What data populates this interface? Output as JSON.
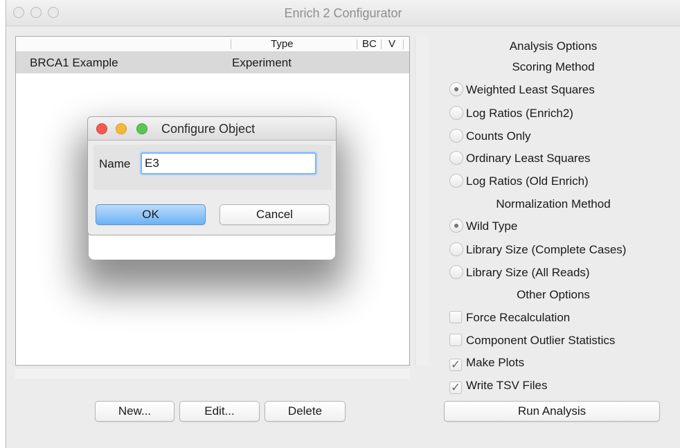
{
  "window": {
    "title": "Enrich 2 Configurator"
  },
  "tree": {
    "columns": [
      "Type",
      "BC",
      "V"
    ],
    "rows": [
      {
        "name": "BRCA1 Example",
        "type": "Experiment"
      }
    ]
  },
  "buttons": {
    "new": "New...",
    "edit": "Edit...",
    "delete": "Delete",
    "run": "Run Analysis"
  },
  "options": {
    "analysis_heading": "Analysis Options",
    "scoring_heading": "Scoring Method",
    "scoring": [
      {
        "label": "Weighted Least Squares",
        "selected": true
      },
      {
        "label": "Log Ratios (Enrich2)",
        "selected": false
      },
      {
        "label": "Counts Only",
        "selected": false
      },
      {
        "label": "Ordinary Least Squares",
        "selected": false
      },
      {
        "label": "Log Ratios (Old Enrich)",
        "selected": false
      }
    ],
    "normalization_heading": "Normalization Method",
    "normalization": [
      {
        "label": "Wild Type",
        "selected": true
      },
      {
        "label": "Library Size (Complete Cases)",
        "selected": false
      },
      {
        "label": "Library Size (All Reads)",
        "selected": false
      }
    ],
    "other_heading": "Other Options",
    "other": [
      {
        "label": "Force Recalculation",
        "checked": false
      },
      {
        "label": "Component Outlier Statistics",
        "checked": false
      },
      {
        "label": "Make Plots",
        "checked": true
      },
      {
        "label": "Write TSV Files",
        "checked": true
      }
    ]
  },
  "dialog": {
    "title": "Configure Object",
    "name_label": "Name",
    "name_value": "E3",
    "ok": "OK",
    "cancel": "Cancel"
  },
  "colors": {
    "close": "#f25a52",
    "minimize": "#f6b73d",
    "zoom": "#5fc456",
    "accent": "#6cb2f6"
  }
}
